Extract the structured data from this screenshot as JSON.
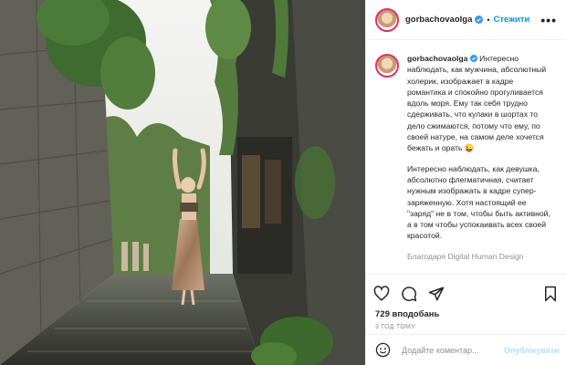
{
  "post": {
    "username": "gorbachovaolga",
    "follow_label": "Стежити",
    "separator": "•",
    "more_label": "•••"
  },
  "caption": {
    "username": "gorbachovaolga",
    "paragraph1": "Интересно наблюдать, как мужчина, абсолютный холерик, изображает в кадре романтика и спокойно прогуливается вдоль моря. Ему так себя трудно сдерживать, что кулаки в шортах то дело сжимаются, потому что ему, по своей натуре, на самом деле хочется бежать и орать 😜",
    "paragraph2": "Интересно наблюдать, как девушка, абсолютно флегматичная, считает нужным изображать в кадре супер-заряженную. Хотя настоящий ее \"заряд\" не в том, чтобы быть активной, а в том чтобы успокаивать всех своей красотой.",
    "paragraph3": "Благодаря Digital Human Design"
  },
  "actions": {
    "likes": "729 вподобань",
    "time": "3 ГОД ТОМУ"
  },
  "comment": {
    "placeholder": "Додайте коментар...",
    "post_label": "Опублікувати"
  },
  "icons": {
    "like": "heart-icon",
    "comment": "comment-icon",
    "share": "share-icon",
    "save": "bookmark-icon",
    "emoji": "emoji-icon",
    "verified": "verified-badge-icon"
  },
  "colors": {
    "accent": "#0095f6",
    "post_disabled": "#b2dffc",
    "muted": "#8e8e8e",
    "text": "#262626"
  }
}
